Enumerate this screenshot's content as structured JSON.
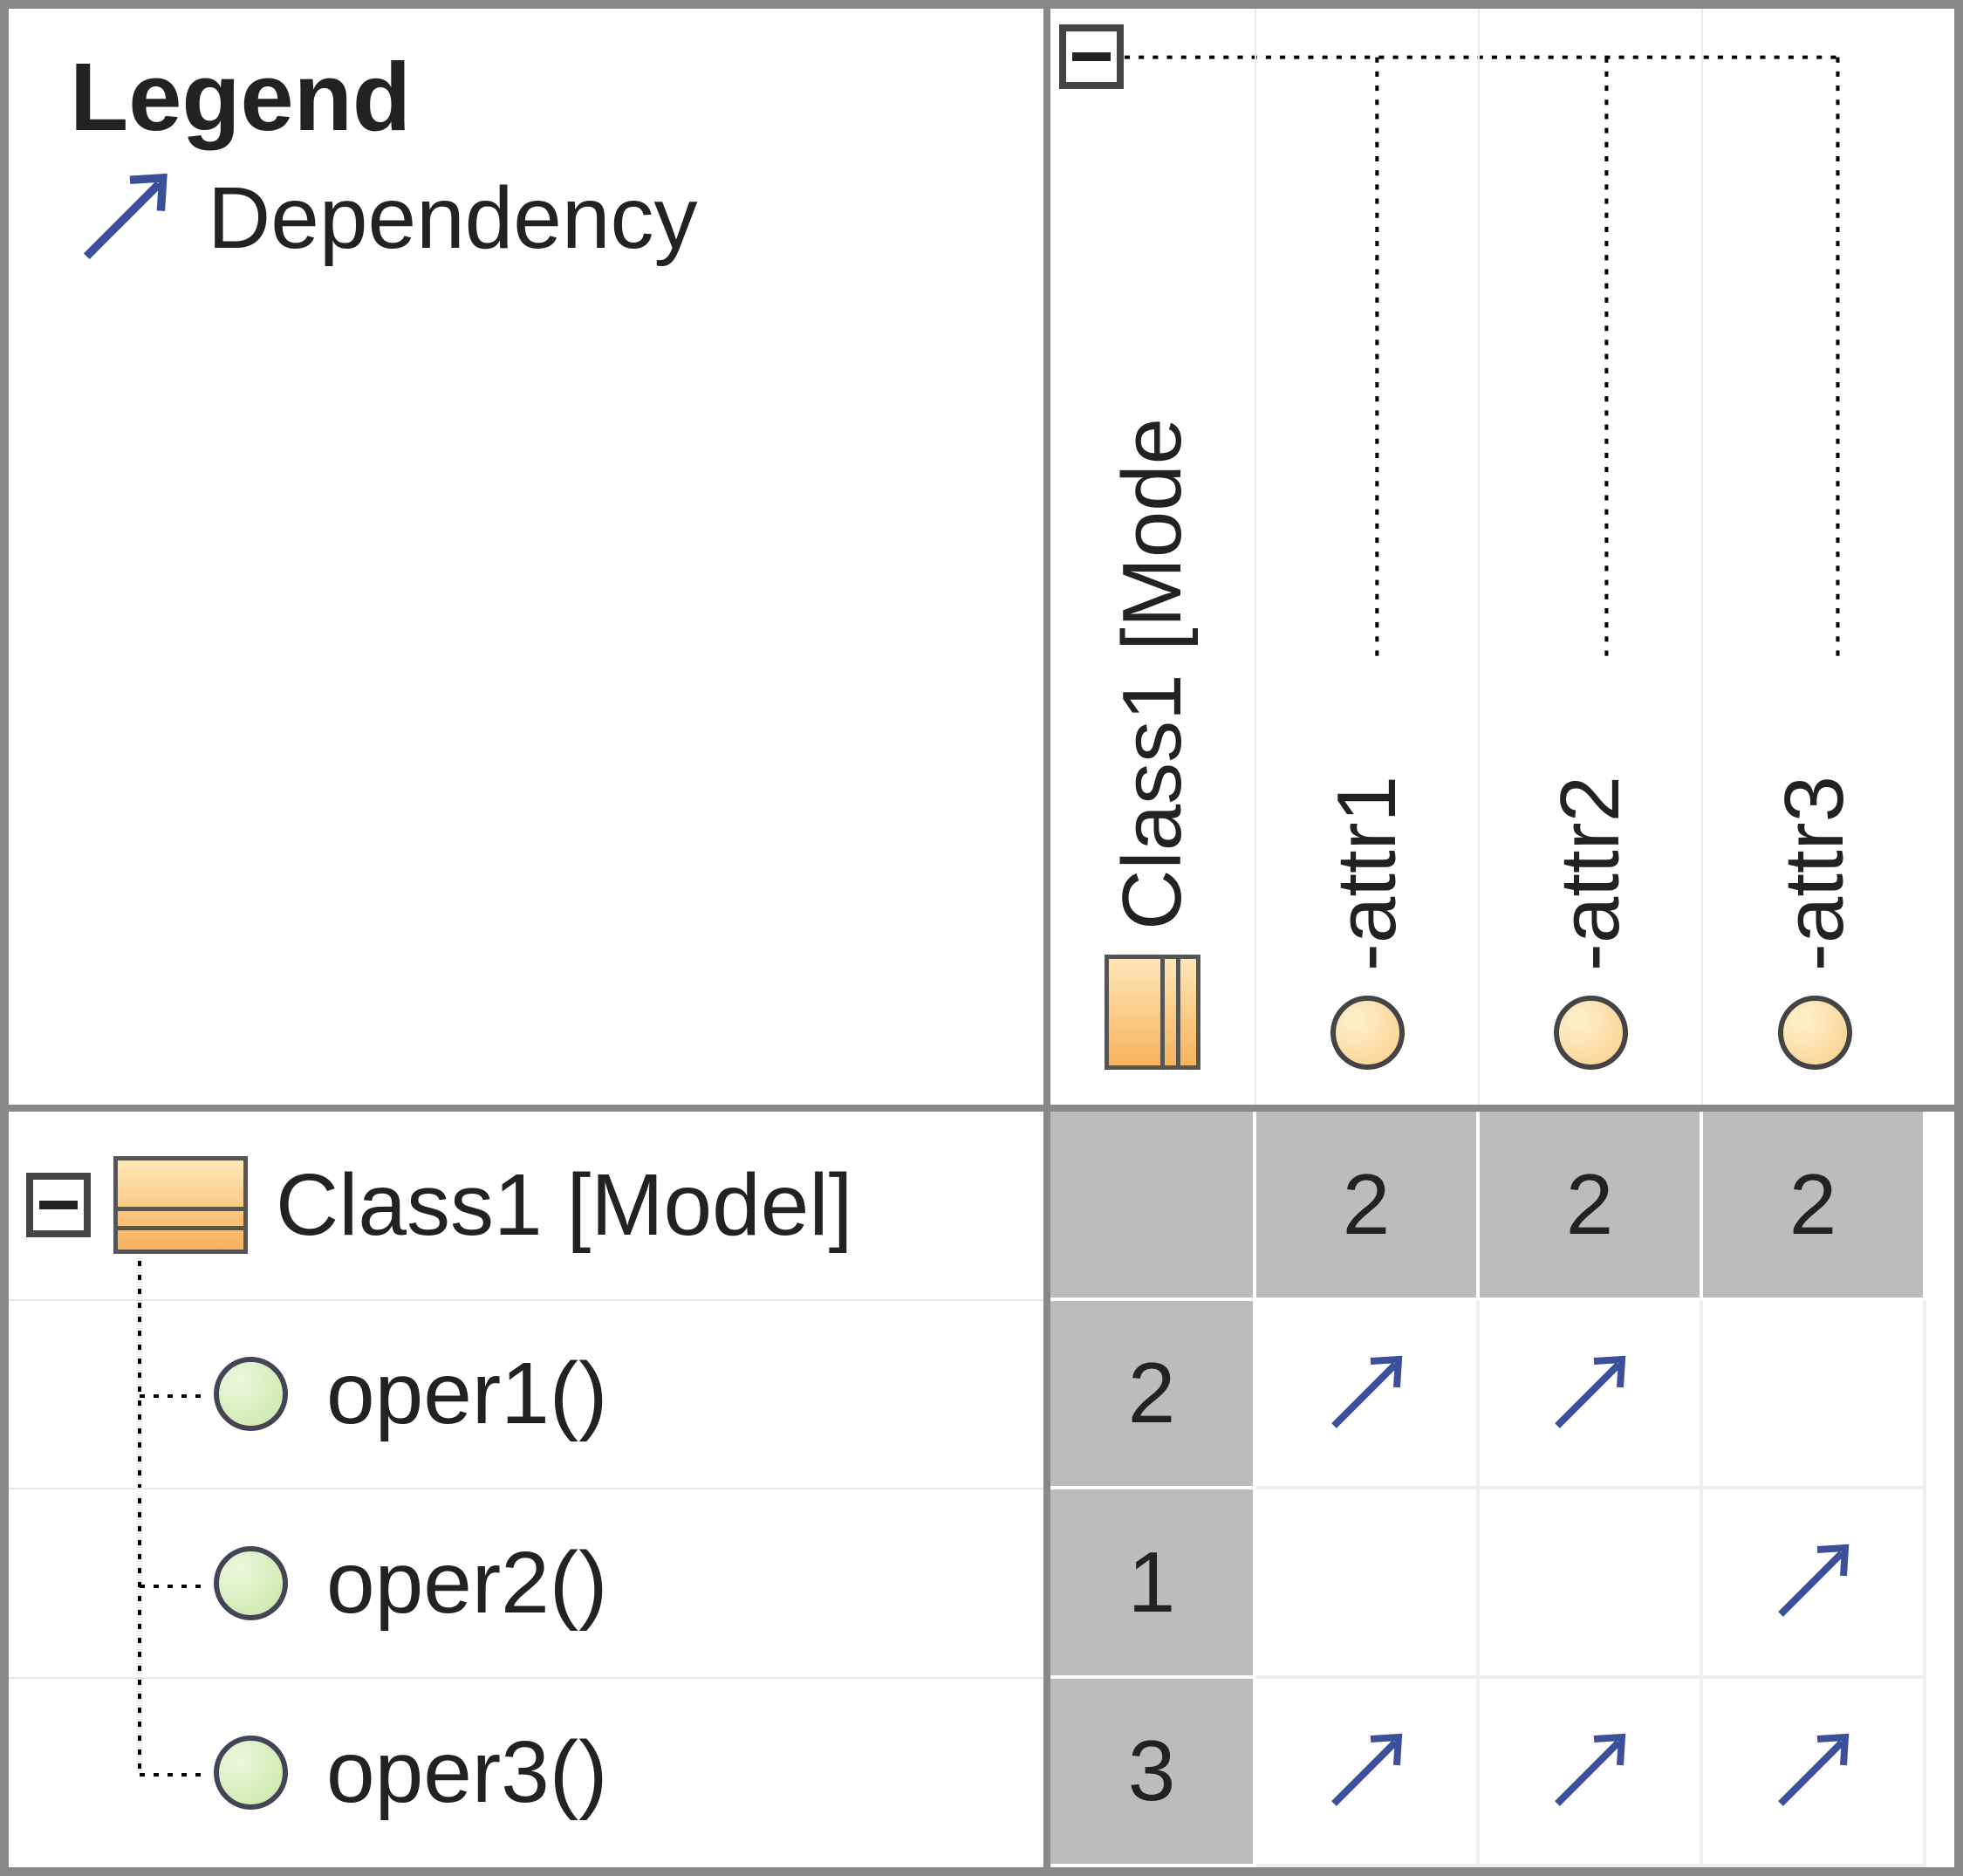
{
  "legend": {
    "title": "Legend",
    "dependency_label": "Dependency"
  },
  "columns": {
    "class_label": "Class1 [Mode",
    "attrs": [
      "-attr1",
      "-attr2",
      "-attr3"
    ]
  },
  "rows": {
    "class_label": "Class1 [Model]",
    "opers": [
      "oper1()",
      "oper2()",
      "oper3()"
    ]
  },
  "matrix": {
    "col_totals": [
      "2",
      "2",
      "2"
    ],
    "row_totals": [
      "2",
      "1",
      "3"
    ],
    "cells": [
      [
        "dep",
        "dep",
        ""
      ],
      [
        "",
        "",
        "dep"
      ],
      [
        "dep",
        "dep",
        "dep"
      ]
    ]
  }
}
